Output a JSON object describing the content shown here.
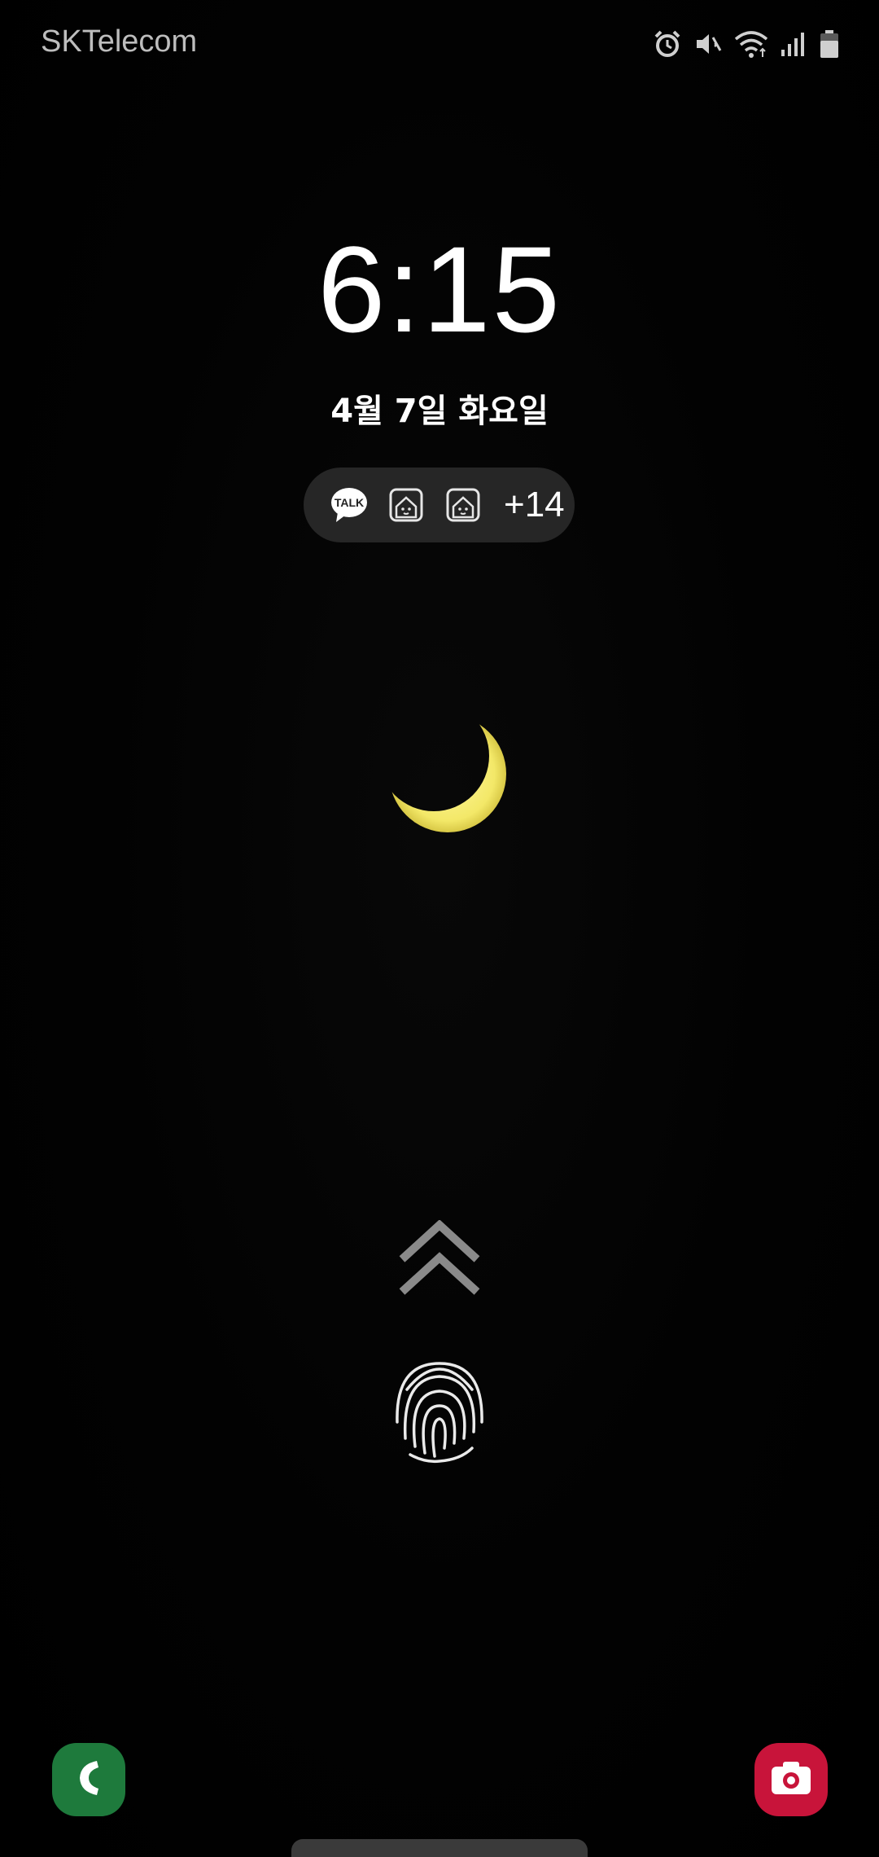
{
  "status_bar": {
    "carrier": "SKTelecom",
    "icons": [
      "alarm-icon",
      "vibrate-mute-icon",
      "wifi-icon",
      "signal-icon",
      "battery-icon"
    ]
  },
  "lock_screen": {
    "time": "6:15",
    "date": "4월 7일 화요일"
  },
  "notifications": {
    "icons": [
      "kakaotalk-icon",
      "home-app-icon",
      "home-app-icon"
    ],
    "talk_label": "TALK",
    "more_count": "+14"
  },
  "wallpaper": {
    "subject": "crescent-moon-icon",
    "moon_color": "#f3e868"
  },
  "shortcuts": {
    "left": "phone-icon",
    "right": "camera-icon",
    "phone_color": "#1e7a3c",
    "camera_color": "#c8143a"
  }
}
